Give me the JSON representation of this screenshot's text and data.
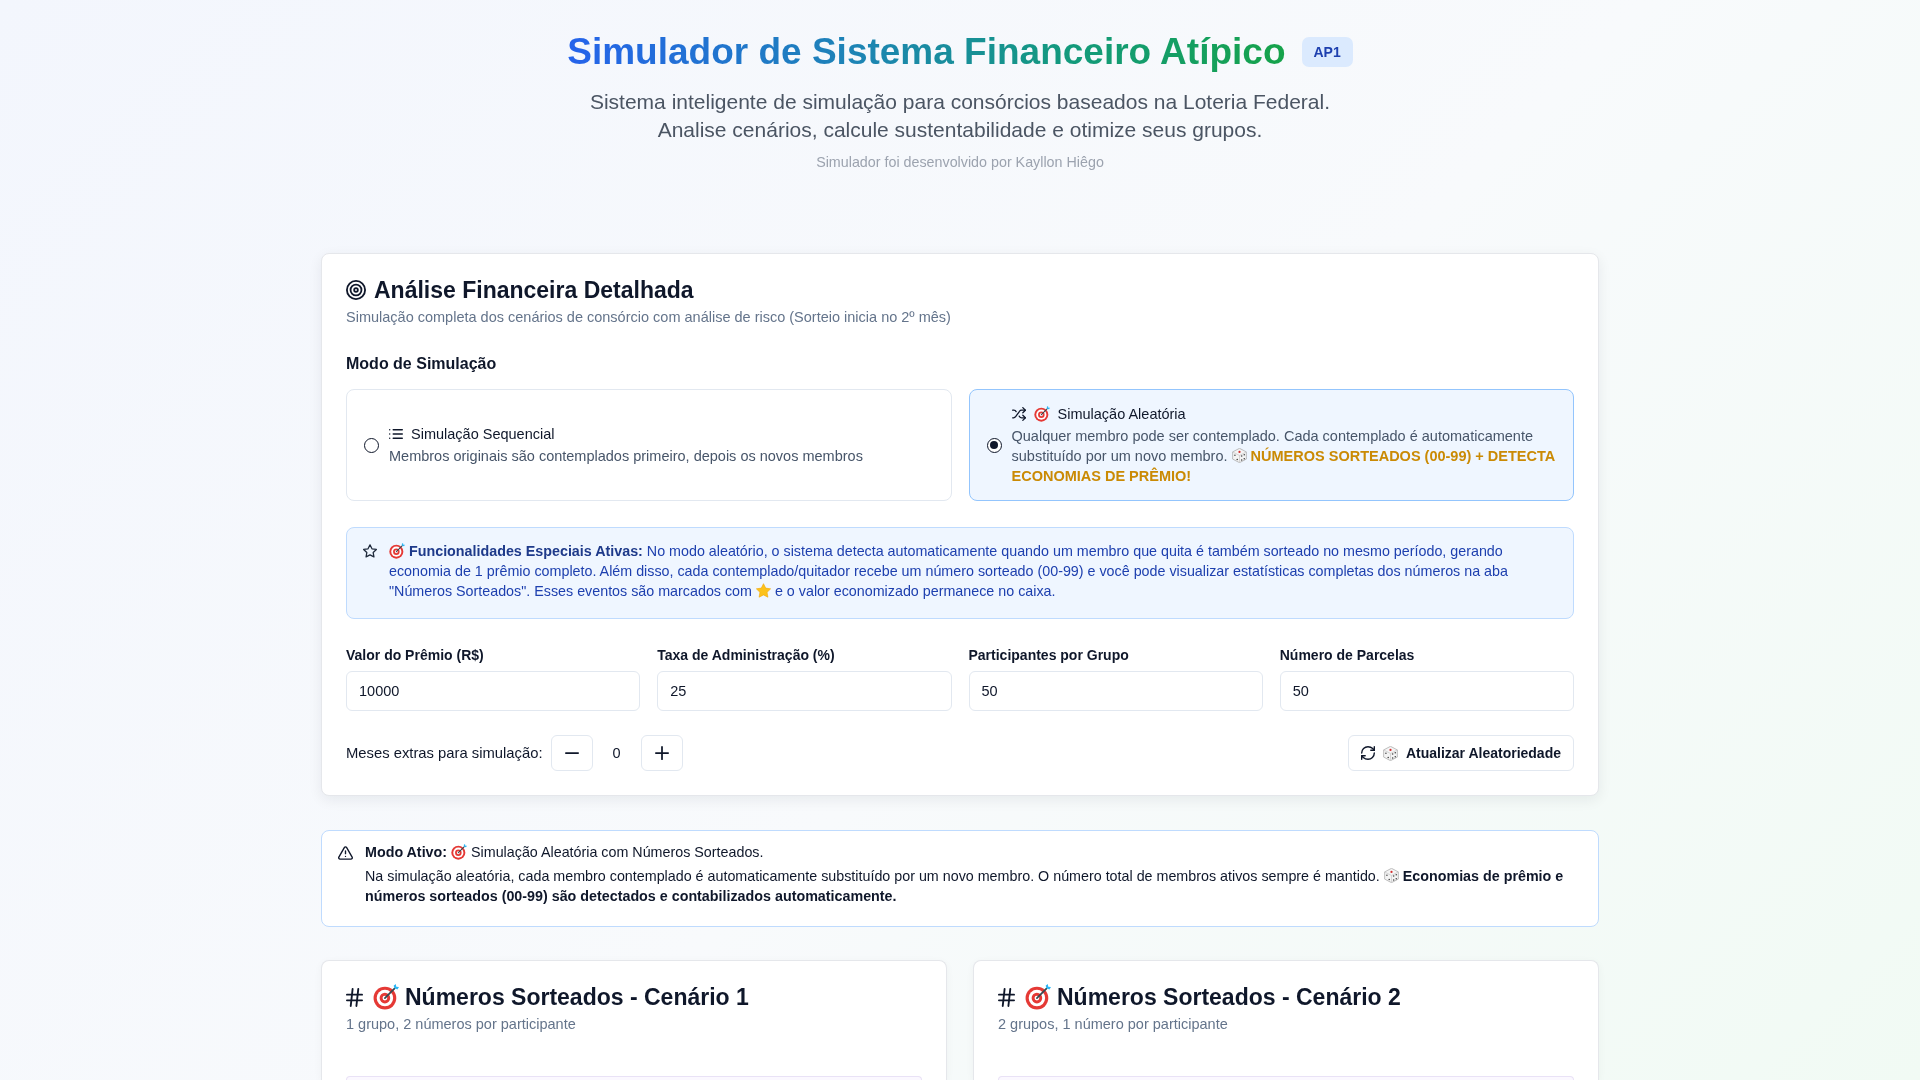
{
  "header": {
    "title": "Simulador de Sistema Financeiro Atípico",
    "badge": "AP1",
    "subtitle_lines": [
      "Sistema inteligente de simulação para consórcios baseados na Loteria Federal.",
      "Analise cenários, calcule sustentabilidade e otimize seus grupos."
    ],
    "credit": "Simulador foi desenvolvido por Kayllon Hiêgo"
  },
  "analysis": {
    "title": "Análise Financeira Detalhada",
    "subtitle": "Simulação completa dos cenários de consórcio com análise de risco (Sorteio inicia no 2º mês)",
    "mode_heading": "Modo de Simulação",
    "modes": [
      {
        "kind": "sequential",
        "title": "Simulação Sequencial",
        "description": "Membros originais são contemplados primeiro, depois os novos membros",
        "selected": false
      },
      {
        "kind": "random",
        "title": "Simulação Aleatória",
        "description": "Qualquer membro pode ser contemplado. Cada contemplado é automaticamente substituído por um novo membro.",
        "highlight": "NÚMEROS SORTEADOS (00-99) + DETECTA ECONOMIAS DE PRÊMIO!",
        "selected": true
      }
    ],
    "notice": {
      "text": "**Funcionalidades Especiais Ativas:** No modo aleatório, o sistema detecta automaticamente quando um membro que quita é também sorteado no mesmo período, gerando economia de 1 prêmio completo. Além disso, cada contemplado/quitador recebe um número sorteado (00-99) e você pode visualizar estatísticas completas dos números na aba \"Números Sorteados\". Esses eventos são marcados com",
      "text_after_icon": "e o valor economizado permanece no caixa."
    },
    "fields": [
      {
        "label": "Valor do Prêmio (R$)",
        "value": "10000"
      },
      {
        "label": "Taxa de Administração (%)",
        "value": "25"
      },
      {
        "label": "Participantes por Grupo",
        "value": "50"
      },
      {
        "label": "Número de Parcelas",
        "value": "50"
      }
    ],
    "extra_months": {
      "label": "Meses extras para simulação:",
      "value": "0"
    },
    "refresh_button": "Atualizar Aleatoriedade"
  },
  "active_mode": {
    "label": "Modo Ativo:",
    "text": "Simulação Aleatória com Números Sorteados.",
    "body": "Na simulação aleatória, cada membro contemplado é automaticamente substituído por um novo membro. O número total de membros ativos sempre é mantido.",
    "emphasis": "Economias de prêmio e números sorteados (00-99) são detectados e contabilizados automaticamente."
  },
  "scenarios": [
    {
      "title": "Números Sorteados - Cenário 1",
      "subtitle": "1 grupo, 2 números por participante"
    },
    {
      "title": "Números Sorteados - Cenário 2",
      "subtitle": "2 grupos, 1 número por participante"
    }
  ]
}
